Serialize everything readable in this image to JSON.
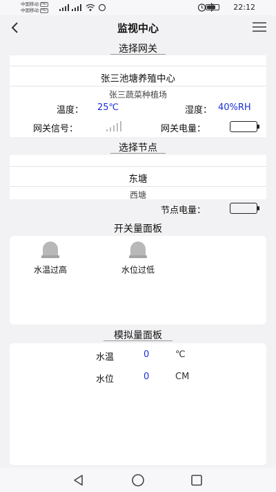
{
  "status_bar": {
    "carrier_1": "中国移动",
    "carrier_2": "中国移动",
    "hd": "HD",
    "time": "22:12"
  },
  "header": {
    "title": "监视中心",
    "back_icon": "back-chevron-icon",
    "menu_icon": "menu-icon"
  },
  "gateway": {
    "section_title": "选择网关",
    "options": [
      "张三池塘养殖中心",
      "张三蔬菜种植场"
    ],
    "temp_label": "温度：",
    "temp_value": "25℃",
    "humidity_label": "湿度：",
    "humidity_value": "40%RH",
    "signal_label": "网关信号：",
    "battery_label": "网关电量："
  },
  "node": {
    "section_title": "选择节点",
    "options": [
      "东塘",
      "西塘"
    ],
    "battery_label": "节点电量："
  },
  "switch_panel": {
    "section_title": "开关量面板",
    "items": [
      {
        "label": "水温过高",
        "icon": "alarm-light-icon"
      },
      {
        "label": "水位过低",
        "icon": "alarm-light-icon"
      }
    ]
  },
  "analog_panel": {
    "section_title": "模拟量面板",
    "rows": [
      {
        "name": "水温",
        "value": "0",
        "unit": "℃"
      },
      {
        "name": "水位",
        "value": "0",
        "unit": "CM"
      }
    ]
  },
  "colors": {
    "value_blue": "#1a2fd6",
    "background": "#f2f2f4"
  }
}
